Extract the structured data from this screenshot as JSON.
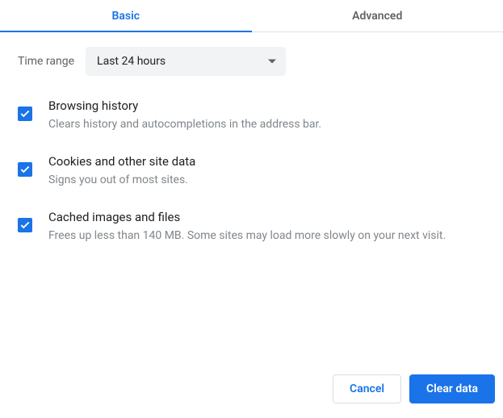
{
  "tabs": {
    "basic": "Basic",
    "advanced": "Advanced"
  },
  "time_range": {
    "label": "Time range",
    "selected": "Last 24 hours"
  },
  "options": [
    {
      "title": "Browsing history",
      "desc": "Clears history and autocompletions in the address bar.",
      "checked": true
    },
    {
      "title": "Cookies and other site data",
      "desc": "Signs you out of most sites.",
      "checked": true
    },
    {
      "title": "Cached images and files",
      "desc": "Frees up less than 140 MB. Some sites may load more slowly on your next visit.",
      "checked": true
    }
  ],
  "buttons": {
    "cancel": "Cancel",
    "clear": "Clear data"
  },
  "colors": {
    "primary": "#1a73e8",
    "text_secondary": "#80868b"
  }
}
